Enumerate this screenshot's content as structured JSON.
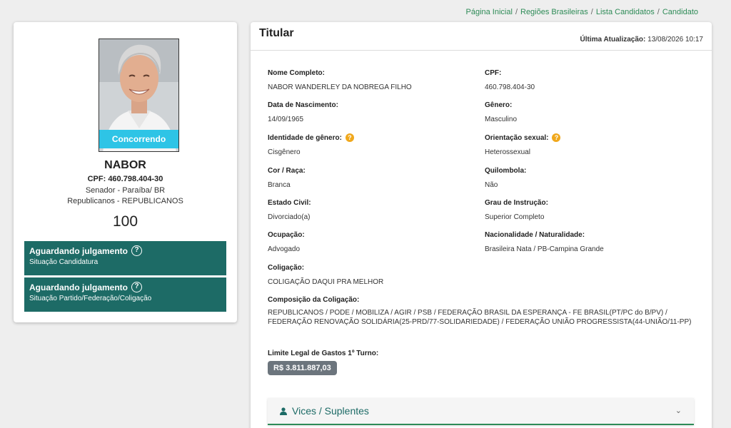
{
  "breadcrumb": {
    "items": [
      "Página Inicial",
      "Regiões Brasileiras",
      "Lista Candidatos",
      "Candidato"
    ],
    "separator": "/"
  },
  "candidate": {
    "photo_status": "Concorrendo",
    "name": "NABOR",
    "cpf_line": "CPF: 460.798.404-30",
    "cargo_line": "Senador - Paraíba/ BR",
    "partido_line": "Republicanos - REPUBLICANOS",
    "number": "100",
    "status_boxes": [
      {
        "title": "Aguardando julgamento",
        "subtitle": "Situação Candidatura"
      },
      {
        "title": "Aguardando julgamento",
        "subtitle": "Situação Partido/Federação/Coligação"
      }
    ]
  },
  "panel": {
    "title": "Titular",
    "update_label": "Última Atualização:",
    "update_value": "13/08/2026 10:17"
  },
  "fields": {
    "nome_completo": {
      "label": "Nome Completo:",
      "value": "NABOR WANDERLEY DA NOBREGA FILHO"
    },
    "cpf": {
      "label": "CPF:",
      "value": "460.798.404-30"
    },
    "nascimento": {
      "label": "Data de Nascimento:",
      "value": "14/09/1965"
    },
    "genero": {
      "label": "Gênero:",
      "value": "Masculino"
    },
    "identidade_genero": {
      "label": "Identidade de gênero:",
      "value": "Cisgênero"
    },
    "orientacao": {
      "label": "Orientação sexual:",
      "value": "Heterossexual"
    },
    "cor_raca": {
      "label": "Cor / Raça:",
      "value": "Branca"
    },
    "quilombola": {
      "label": "Quilombola:",
      "value": "Não"
    },
    "estado_civil": {
      "label": "Estado Civil:",
      "value": "Divorciado(a)"
    },
    "grau_instrucao": {
      "label": "Grau de Instrução:",
      "value": "Superior Completo"
    },
    "ocupacao": {
      "label": "Ocupação:",
      "value": "Advogado"
    },
    "nacionalidade": {
      "label": "Nacionalidade / Naturalidade:",
      "value": "Brasileira Nata / PB-Campina Grande"
    },
    "coligacao": {
      "label": "Coligação:",
      "value": "COLIGAÇÃO DAQUI PRA MELHOR"
    },
    "composicao": {
      "label": "Composição da Coligação:",
      "value": "REPUBLICANOS / PODE / MOBILIZA / AGIR / PSB / FEDERAÇÃO BRASIL DA ESPERANÇA - FE BRASIL(PT/PC do B/PV) / FEDERAÇÃO RENOVAÇÃO SOLIDÁRIA(25-PRD/77-SOLIDARIEDADE) / FEDERAÇÃO UNIÃO PROGRESSISTA(44-UNIÃO/11-PP)"
    },
    "limite_gastos": {
      "label": "Limite Legal de Gastos 1º Turno:",
      "value": "R$ 3.811.887,03"
    }
  },
  "accordion": {
    "label": "Vices / Suplentes"
  },
  "icons": {
    "question_badge": "?",
    "chevron": "⌄"
  },
  "colors": {
    "accent_green": "#2e8b57",
    "status_teal": "#1d6b66",
    "photo_status_cyan": "#2ec4e6",
    "question_badge": "#f0a81c",
    "money_badge": "#6c757d"
  }
}
